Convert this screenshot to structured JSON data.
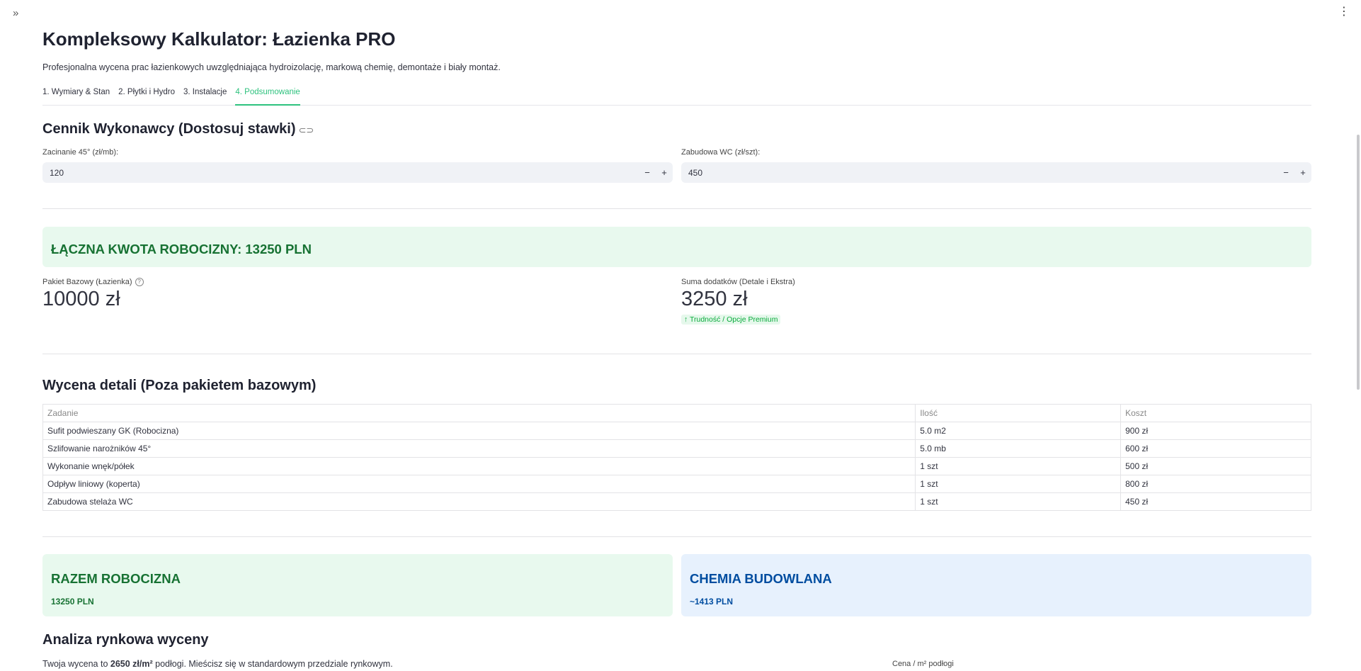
{
  "app": {
    "title": "Kompleksowy Kalkulator: Łazienka PRO",
    "subtitle": "Profesjonalna wycena prac łazienkowych uwzględniająca hydroizolację, markową chemię, demontaże i biały montaż."
  },
  "chrome": {
    "sidebar_toggle": "»",
    "menu": "⋮"
  },
  "tabs": [
    {
      "label": "1. Wymiary & Stan",
      "active": false
    },
    {
      "label": "2. Płytki i Hydro",
      "active": false
    },
    {
      "label": "3. Instalacje",
      "active": false
    },
    {
      "label": "4. Podsumowanie",
      "active": true
    }
  ],
  "pricing": {
    "title": "Cennik Wykonawcy (Dostosuj stawki)",
    "link_icon": "link-icon",
    "fields": [
      {
        "label": "Zacinanie 45° (zł/mb):",
        "value": "120",
        "minus": "−",
        "plus": "+"
      },
      {
        "label": "Zabudowa WC (zł/szt):",
        "value": "450",
        "minus": "−",
        "plus": "+"
      }
    ]
  },
  "total_banner": "ŁĄCZNA KWOTA ROBOCIZNY: 13250 PLN",
  "metrics": [
    {
      "label": "Pakiet Bazowy (Łazienka)",
      "value": "10000 zł",
      "help_icon": "?"
    },
    {
      "label": "Suma dodatków (Detale i Ekstra)",
      "value": "3250 zł",
      "delta": "↑ Trudność / Opcje Premium"
    }
  ],
  "details": {
    "title": "Wycena detali (Poza pakietem bazowym)",
    "columns": [
      "Zadanie",
      "Ilość",
      "Koszt"
    ],
    "rows": [
      [
        "Sufit podwieszany GK (Robocizna)",
        "5.0 m2",
        "900 zł"
      ],
      [
        "Szlifowanie narożników 45°",
        "5.0 mb",
        "600 zł"
      ],
      [
        "Wykonanie wnęk/półek",
        "1 szt",
        "500 zł"
      ],
      [
        "Odpływ liniowy (koperta)",
        "1 szt",
        "800 zł"
      ],
      [
        "Zabudowa stelaża WC",
        "1 szt",
        "450 zł"
      ]
    ]
  },
  "summary_cards": [
    {
      "title": "RAZEM ROBOCIZNA",
      "value": "13250 PLN",
      "color": "#177233"
    },
    {
      "title": "CHEMIA BUDOWLANA",
      "value": "~1413 PLN",
      "color": "#004da0"
    }
  ],
  "analysis": {
    "title": "Analiza rynkowa wyceny",
    "text_before": "Twoja wycena to ",
    "text_bold": "2650 zł/m²",
    "text_after": " podłogi. Mieścisz się w standardowym przedziale rynkowym.",
    "price_label": "Cena / m² podłogi"
  }
}
